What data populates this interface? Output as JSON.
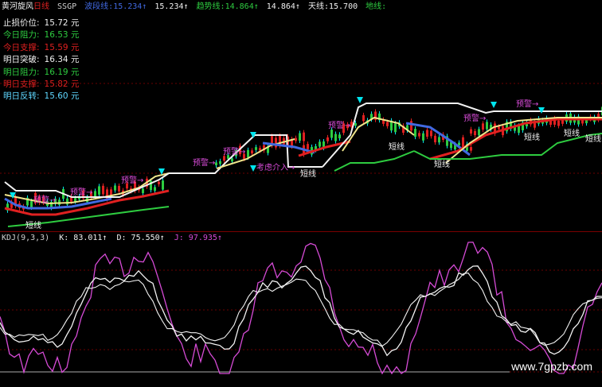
{
  "colors": {
    "bg": "#000000",
    "white": "#f2f2f2",
    "yellow": "#f0e68c",
    "red": "#e02020",
    "green": "#2ecc40",
    "blue": "#4169e1",
    "cyan": "#00e5ee",
    "magenta": "#d64bd6",
    "grid_red": "#6b0000"
  },
  "header": {
    "title": "黄河旋风",
    "period": "日线",
    "code": "SSGP",
    "seg1_label": "波段线:",
    "seg1_value": "15.234↑",
    "seg2_value": "15.234↑",
    "trend_label": "趋势线:",
    "trend_value": "14.864↑",
    "seg3_value": "14.864↑",
    "sky_label": "天线:",
    "sky_value": "15.700",
    "ground_label": "地线:"
  },
  "levels": [
    {
      "label": "止损价位:",
      "value": "15.72 元",
      "color": "#f0f0f0"
    },
    {
      "label": "今日阻力:",
      "value": "16.53 元",
      "color": "#2ecc40"
    },
    {
      "label": "今日支撑:",
      "value": "15.59 元",
      "color": "#e02020"
    },
    {
      "label": "明日突破:",
      "value": "16.34 元",
      "color": "#f0f0f0"
    },
    {
      "label": "明日阻力:",
      "value": "16.19 元",
      "color": "#2ecc40"
    },
    {
      "label": "明日支撑:",
      "value": "15.82 元",
      "color": "#e02020"
    },
    {
      "label": "明日反转:",
      "value": "15.60 元",
      "color": "#5fd7ff"
    }
  ],
  "annotations": {
    "warning": "预警→",
    "short_line": "短线",
    "consider": "考虑介入→"
  },
  "kdj": {
    "name": "KDJ(9,3,3)",
    "k": "K: 83.011↑",
    "d": "D: 75.550↑",
    "j": "J: 97.935↑"
  },
  "watermark": "www.7gpzb.com"
}
